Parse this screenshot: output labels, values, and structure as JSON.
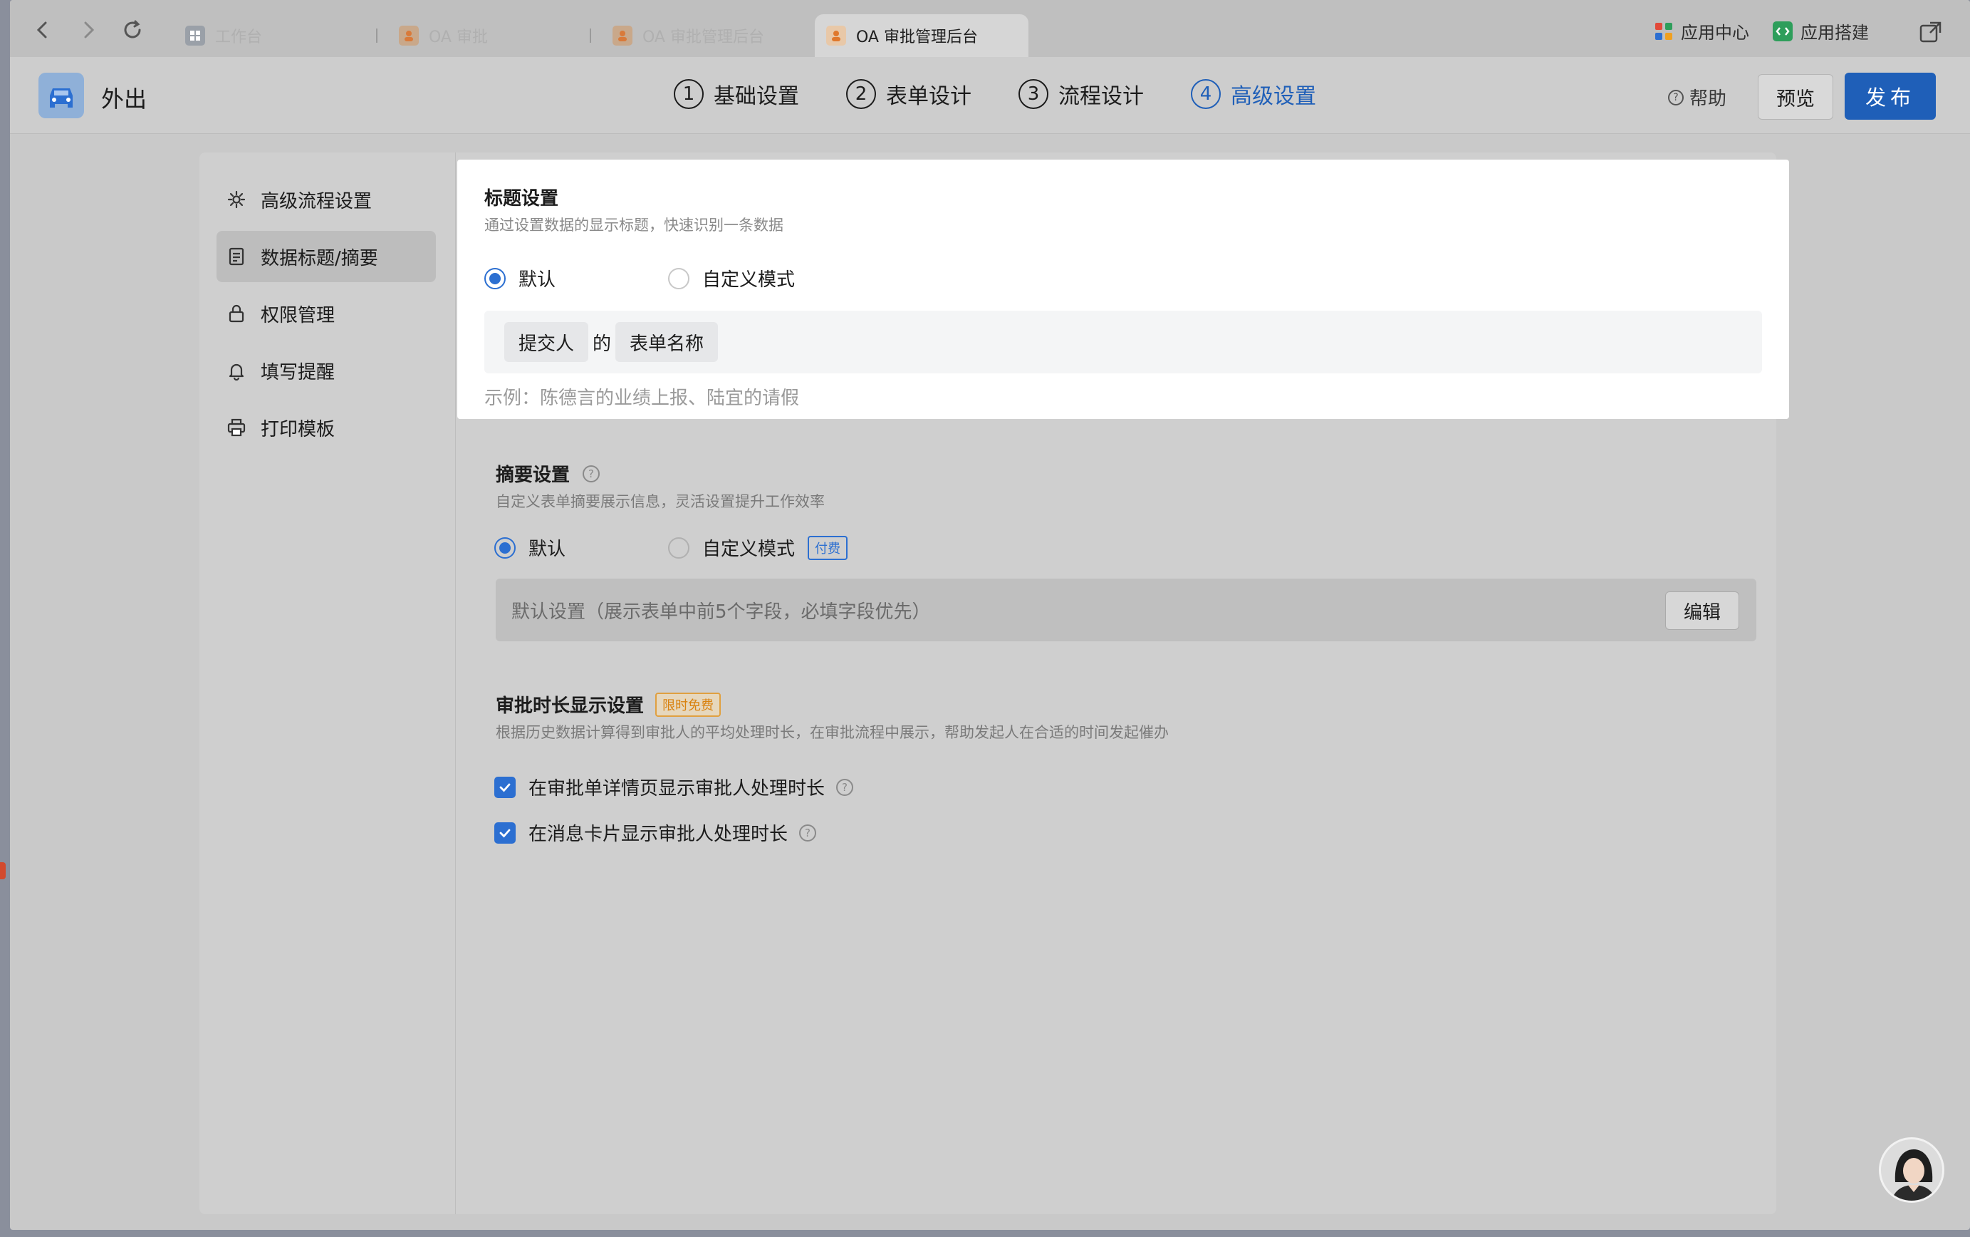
{
  "browser": {
    "tabs": [
      {
        "label": "工作台",
        "icon": "workbench-icon"
      },
      {
        "label": "OA 审批",
        "icon": "oa-icon"
      },
      {
        "label": "OA 审批管理后台",
        "icon": "oa-icon"
      },
      {
        "label": "OA 审批管理后台",
        "icon": "oa-icon",
        "active": true
      }
    ],
    "right": {
      "app_center": "应用中心",
      "app_builder": "应用搭建"
    }
  },
  "header": {
    "app_name": "外出",
    "steps": [
      {
        "num": "1",
        "label": "基础设置"
      },
      {
        "num": "2",
        "label": "表单设计"
      },
      {
        "num": "3",
        "label": "流程设计"
      },
      {
        "num": "4",
        "label": "高级设置",
        "active": true
      }
    ],
    "help": "帮助",
    "preview": "预览",
    "publish": "发布"
  },
  "sidebar": {
    "items": [
      {
        "label": "高级流程设置",
        "icon": "gear-icon"
      },
      {
        "label": "数据标题/摘要",
        "icon": "document-icon",
        "active": true
      },
      {
        "label": "权限管理",
        "icon": "lock-icon"
      },
      {
        "label": "填写提醒",
        "icon": "bell-icon"
      },
      {
        "label": "打印模板",
        "icon": "printer-icon"
      }
    ]
  },
  "title_settings": {
    "title": "标题设置",
    "desc": "通过设置数据的显示标题，快速识别一条数据",
    "option_default": "默认",
    "option_custom": "自定义模式",
    "selected": "default",
    "chip_submitter": "提交人",
    "joiner": "的",
    "chip_form_name": "表单名称",
    "example": "示例：陈德言的业绩上报、陆宜的请假"
  },
  "summary_settings": {
    "title": "摘要设置",
    "help_mark": "?",
    "desc": "自定义表单摘要展示信息，灵活设置提升工作效率",
    "option_default": "默认",
    "option_custom": "自定义模式",
    "paid_badge": "付费",
    "selected": "default",
    "default_text": "默认设置（展示表单中前5个字段，必填字段优先）",
    "edit": "编辑"
  },
  "duration_settings": {
    "title": "审批时长显示设置",
    "free_badge": "限时免费",
    "desc": "根据历史数据计算得到审批人的平均处理时长，在审批流程中展示，帮助发起人在合适的时间发起催办",
    "checkbox_detail": "在审批单详情页显示审批人处理时长",
    "checkbox_message": "在消息卡片显示审批人处理时长",
    "help_mark": "?",
    "detail_checked": true,
    "message_checked": true
  },
  "colors": {
    "accent": "#1f5fb8",
    "radio_checked": "#2c6fd1",
    "free_badge": "#d9820f"
  }
}
